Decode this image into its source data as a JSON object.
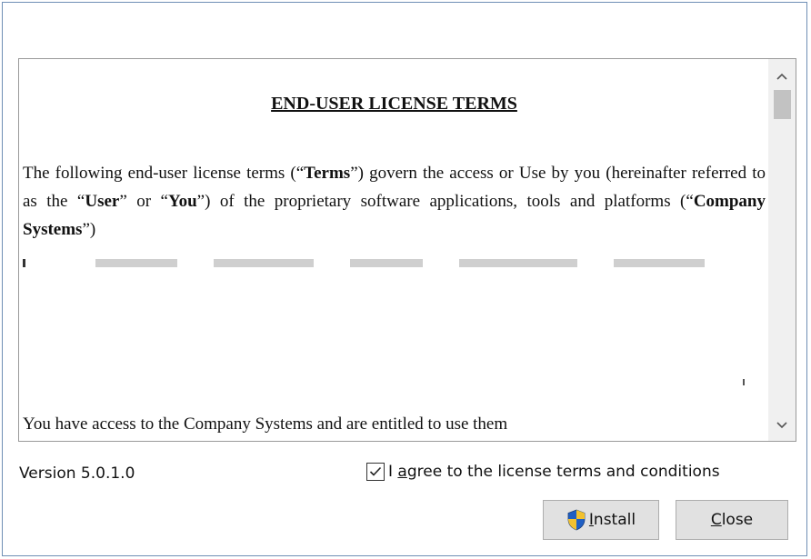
{
  "eula": {
    "title": "END-USER LICENSE TERMS",
    "para_1": "The following end-user license terms (“",
    "bold_terms": "Terms",
    "para_2": "”) govern the access or Use by you (hereinafter referred to as the “",
    "bold_user": "User",
    "para_3": "” or “",
    "bold_you": "You",
    "para_4": "”) of the proprietary software applications, tools and platforms (“",
    "bold_company_systems": "Company Systems",
    "para_5": "”)",
    "bottom_line": "You have access to the Company Systems and are entitled to use them"
  },
  "footer": {
    "version": "Version 5.0.1.0",
    "agree_checked": true,
    "agree_pre": "I ",
    "agree_mnemonic": "a",
    "agree_post": "gree to the license terms and conditions"
  },
  "buttons": {
    "install_mnemonic": "I",
    "install_rest": "nstall",
    "close_mnemonic": "C",
    "close_rest": "lose"
  },
  "icons": {
    "shield": "uac-shield-icon",
    "check": "check-icon",
    "scroll_up": "chevron-up-icon",
    "scroll_down": "chevron-down-icon"
  },
  "colors": {
    "window_border": "#6f8fb5",
    "button_bg": "#e1e1e1",
    "shield_blue": "#1f5fc4",
    "shield_yellow": "#f2c12e"
  }
}
